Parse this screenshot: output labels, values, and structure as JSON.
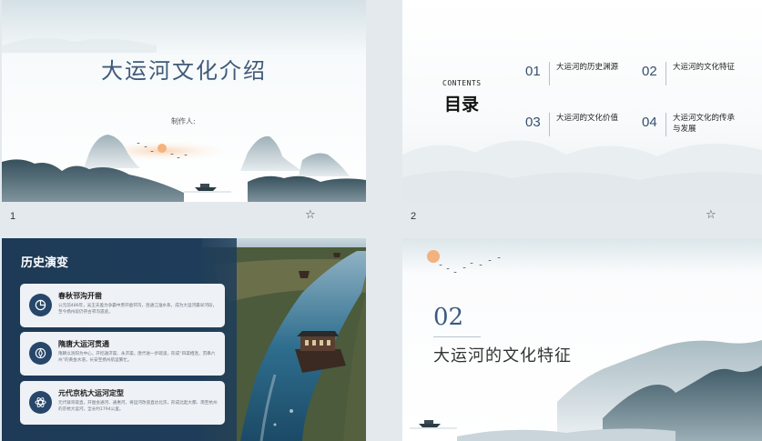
{
  "slides": [
    {
      "number": "1",
      "title": "大运河文化介绍",
      "maker_label": "制作人:"
    },
    {
      "number": "2",
      "contents_label": "CONTENTS",
      "heading": "目录",
      "toc": [
        {
          "num": "01",
          "label": "大运河的历史渊源"
        },
        {
          "num": "02",
          "label": "大运河的文化特征"
        },
        {
          "num": "03",
          "label": "大运河的文化价值"
        },
        {
          "num": "04",
          "label": "大运河文化的传承与发展"
        }
      ]
    },
    {
      "title": "历史演变",
      "cards": [
        {
          "title": "春秋邗沟开凿",
          "desc": "公元前486年，吴王夫差为争霸中原开凿邗沟，连通江淮水系，成为大运河最早河段，至今扬州段仍存古邗沟遗迹。",
          "icon": "pie-chart-icon"
        },
        {
          "title": "隋唐大运河贯通",
          "desc": "隋朝以洛阳为中心，开挖通济渠、永济渠，唐代进一步疏浚，形成“四渠相连，贯串六州”的黄金水道，长安至扬州航运繁忙。",
          "icon": "compass-icon"
        },
        {
          "title": "元代京杭大运河定型",
          "desc": "元代裁弯取直，开凿会通河、通惠河，将运河改道直达北京，形成北起大都、南至杭州的京杭大运河，全长约1794公里。",
          "icon": "atom-icon"
        }
      ]
    },
    {
      "section_number": "02",
      "section_title": "大运河的文化特征"
    }
  ],
  "colors": {
    "page_bg": "#e4e9ee",
    "navy": "#1e3a56",
    "title_blue": "#3f5a78"
  }
}
